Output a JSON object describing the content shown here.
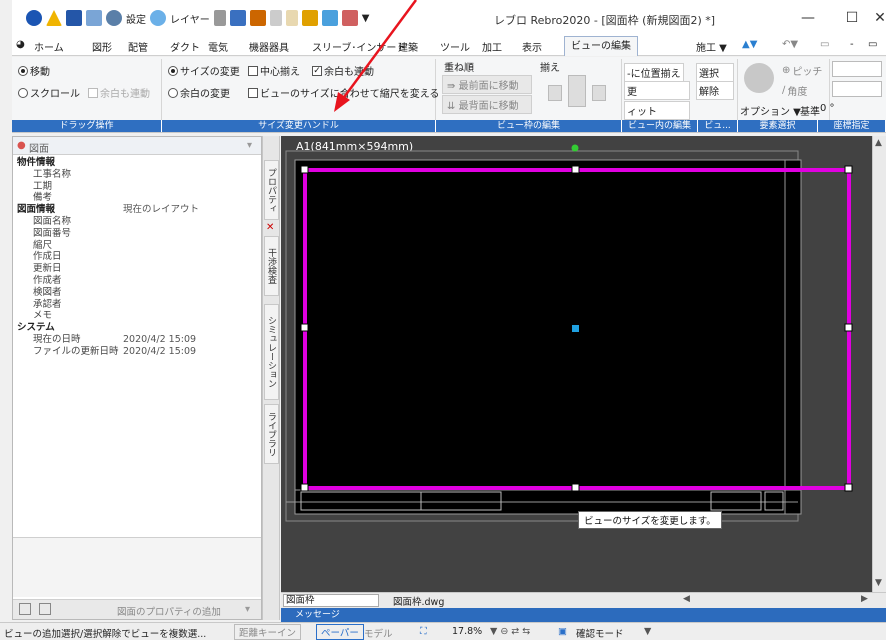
{
  "title_bar": {
    "settings_label": "設定",
    "layer_label": "レイヤー",
    "window_title": "レブロ Rebro2020 - [図面枠 (新規図面2) *]",
    "minimize": "—",
    "maximize": "☐",
    "close": "✕"
  },
  "tabs": [
    "ホーム",
    "図形",
    "配管",
    "ダクト",
    "電気",
    "機器器具",
    "スリーブ･インサート",
    "建築",
    "ツール",
    "加工",
    "表示"
  ],
  "active_tab": "ビューの編集",
  "tabs_right": {
    "construct": "施工 ▼"
  },
  "ribbon": {
    "drag": {
      "move": "移動",
      "scroll": "スクロール",
      "margin_link": "余白も連動",
      "group": "ドラッグ操作"
    },
    "resize": {
      "size_change": "サイズの変更",
      "center_align": "中心揃え",
      "margin_link": "余白も連動",
      "margin_change": "余白の変更",
      "fit_view": "ビューのサイズに合わせて縮尺を変える",
      "group": "サイズ変更ハンドル"
    },
    "frame": {
      "order": "重ね順",
      "align": "揃え",
      "to_front": "最前面に移動",
      "to_back": "最背面に移動",
      "group": "ビュー枠の編集"
    },
    "inner": {
      "pos_align": "-に位置揃え",
      "change": "更",
      "widget": "ィット",
      "select": "選択",
      "release": "解除",
      "group": "ビュー内の編集",
      "group2": "ビュ..."
    },
    "element": {
      "options": "オプション ▼",
      "basis": "基準",
      "basis_value": "0 °",
      "pitch": "ピッチ",
      "angle": "角度",
      "group": "要素選択"
    },
    "coord": {
      "group": "座標指定"
    }
  },
  "left_panel": {
    "dropdown": "図面",
    "rows": [
      {
        "type": "section",
        "key": "物件情報"
      },
      {
        "type": "item",
        "key": "工事名称",
        "value": ""
      },
      {
        "type": "item",
        "key": "工期",
        "value": ""
      },
      {
        "type": "item",
        "key": "備考",
        "value": ""
      },
      {
        "type": "section",
        "key": "図面情報",
        "value": "現在のレイアウト"
      },
      {
        "type": "item",
        "key": "図面名称",
        "value": ""
      },
      {
        "type": "item",
        "key": "図面番号",
        "value": ""
      },
      {
        "type": "item",
        "key": "縮尺",
        "value": ""
      },
      {
        "type": "item",
        "key": "作成日",
        "value": ""
      },
      {
        "type": "item",
        "key": "更新日",
        "value": ""
      },
      {
        "type": "item",
        "key": "作成者",
        "value": ""
      },
      {
        "type": "item",
        "key": "検図者",
        "value": ""
      },
      {
        "type": "item",
        "key": "承認者",
        "value": ""
      },
      {
        "type": "item",
        "key": "メモ",
        "value": ""
      },
      {
        "type": "section",
        "key": "システム"
      },
      {
        "type": "item",
        "key": "現在の日時",
        "value": "2020/4/2 15:09"
      },
      {
        "type": "item",
        "key": "ファイルの更新日時",
        "value": "2020/4/2 15:09"
      }
    ],
    "add_property": "図面のプロパティの追加"
  },
  "side_tabs": [
    "プロパティ",
    "干渉検査",
    "シミュレーション",
    "ライブラリ"
  ],
  "canvas": {
    "paper_label": "A1(841mm×594mm)",
    "tooltip": "ビューのサイズを変更します。",
    "tab1": "図面枠",
    "tab2": "図面枠.dwg",
    "message": "メッセージ"
  },
  "status_bar": {
    "hint": "ビューの追加選択/選択解除でビューを複数選...",
    "distance_key": "距離キーイン",
    "paper": "ペーパー",
    "model": "モデル",
    "zoom": "17.8%",
    "confirm_mode": "確認モード"
  },
  "colors": {
    "ribbon_group_label": "#2f6fc1",
    "selection": "#e000e0",
    "handle_center": "#1fa0e0",
    "rotate_handle": "#33cc33"
  }
}
